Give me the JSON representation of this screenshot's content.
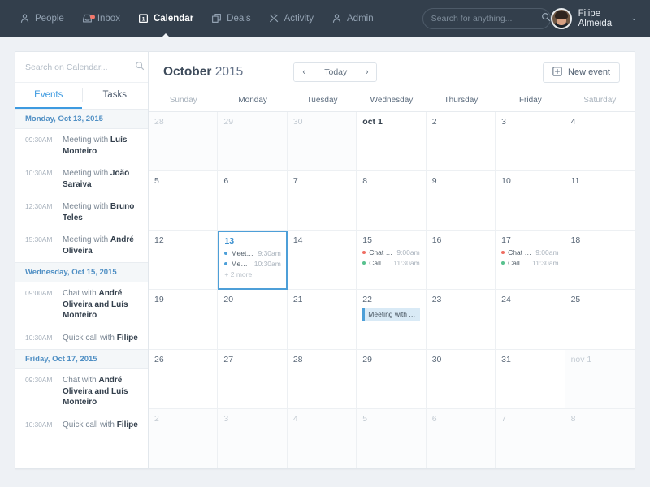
{
  "topnav": {
    "items": [
      {
        "label": "People",
        "icon": "people-icon",
        "active": false,
        "badge": false
      },
      {
        "label": "Inbox",
        "icon": "inbox-icon",
        "active": false,
        "badge": true
      },
      {
        "label": "Calendar",
        "icon": "calendar-icon",
        "active": true,
        "badge": false
      },
      {
        "label": "Deals",
        "icon": "deals-icon",
        "active": false,
        "badge": false
      },
      {
        "label": "Activity",
        "icon": "activity-icon",
        "active": false,
        "badge": false
      },
      {
        "label": "Admin",
        "icon": "admin-icon",
        "active": false,
        "badge": false
      }
    ],
    "search": {
      "placeholder": "Search for anything...",
      "value": "",
      "icon": "search-icon"
    },
    "user": {
      "name": "Filipe Almeida",
      "caret": "⌄",
      "avatar": "avatar"
    },
    "bar_color": "#333f4c",
    "accent_color": "#3d9ae0",
    "badge_color": "#f2776b"
  },
  "sidebar": {
    "search": {
      "placeholder": "Search on Calendar...",
      "value": "",
      "icon": "search-icon"
    },
    "tabs": [
      {
        "label": "Events",
        "active": true
      },
      {
        "label": "Tasks",
        "active": false
      }
    ],
    "days": [
      {
        "header": "Monday, Oct 13, 2015",
        "events": [
          {
            "time": "09:30AM",
            "prefix": "Meeting with ",
            "name": "Luís Monteiro"
          },
          {
            "time": "10:30AM",
            "prefix": "Meeting with ",
            "name": "João Saraiva"
          },
          {
            "time": "12:30AM",
            "prefix": "Meeting with ",
            "name": "Bruno Teles"
          },
          {
            "time": "15:30AM",
            "prefix": "Meeting with ",
            "name": "André Oliveira"
          }
        ]
      },
      {
        "header": "Wednesday, Oct 15, 2015",
        "events": [
          {
            "time": "09:00AM",
            "prefix": "Chat with ",
            "name": "André Oliveira and Luís Monteiro"
          },
          {
            "time": "10:30AM",
            "prefix": "Quick call with ",
            "name": "Filipe"
          }
        ]
      },
      {
        "header": "Friday, Oct 17, 2015",
        "events": [
          {
            "time": "09:30AM",
            "prefix": "Chat with ",
            "name": "André Oliveira and Luís Monteiro"
          },
          {
            "time": "10:30AM",
            "prefix": "Quick call with ",
            "name": "Filipe"
          }
        ]
      }
    ]
  },
  "calendar": {
    "month": "October",
    "year": "2015",
    "prev_label": "‹",
    "today_label": "Today",
    "next_label": "›",
    "new_event_label": "New event",
    "new_event_icon": "plus-square-icon",
    "weekdays": [
      {
        "label": "Sunday",
        "weekend": true
      },
      {
        "label": "Monday",
        "weekend": false
      },
      {
        "label": "Tuesday",
        "weekend": false
      },
      {
        "label": "Wednesday",
        "weekend": false
      },
      {
        "label": "Thursday",
        "weekend": false
      },
      {
        "label": "Friday",
        "weekend": false
      },
      {
        "label": "Saturday",
        "weekend": true
      }
    ],
    "cells": [
      {
        "day": "28",
        "other": true
      },
      {
        "day": "29",
        "other": true
      },
      {
        "day": "30",
        "other": true
      },
      {
        "day": "oct 1",
        "first": true
      },
      {
        "day": "2"
      },
      {
        "day": "3"
      },
      {
        "day": "4"
      },
      {
        "day": "5"
      },
      {
        "day": "6"
      },
      {
        "day": "7"
      },
      {
        "day": "8"
      },
      {
        "day": "9"
      },
      {
        "day": "10"
      },
      {
        "day": "11"
      },
      {
        "day": "12"
      },
      {
        "day": "13",
        "selected": true,
        "events": [
          {
            "name": "Meeting w…",
            "time": "9:30am",
            "color": "#4d9fd8"
          },
          {
            "name": "Meeting…",
            "time": "10:30am",
            "color": "#4d9fd8"
          }
        ],
        "more": "+ 2 more"
      },
      {
        "day": "14"
      },
      {
        "day": "15",
        "events": [
          {
            "name": "Chat with..",
            "time": "9:00am",
            "color": "#ef6d62"
          },
          {
            "name": "Call with..",
            "time": "11:30am",
            "color": "#58c18e"
          }
        ]
      },
      {
        "day": "16"
      },
      {
        "day": "17",
        "events": [
          {
            "name": "Chat with..",
            "time": "9:00am",
            "color": "#ef6d62"
          },
          {
            "name": "Call with..",
            "time": "11:30am",
            "color": "#58c18e"
          }
        ]
      },
      {
        "day": "18"
      },
      {
        "day": "19"
      },
      {
        "day": "20"
      },
      {
        "day": "21"
      },
      {
        "day": "22",
        "bar_event": "Meeting with Andr…"
      },
      {
        "day": "23"
      },
      {
        "day": "24"
      },
      {
        "day": "25"
      },
      {
        "day": "26"
      },
      {
        "day": "27"
      },
      {
        "day": "28"
      },
      {
        "day": "29"
      },
      {
        "day": "30"
      },
      {
        "day": "31"
      },
      {
        "day": "nov 1",
        "other": true
      },
      {
        "day": "2",
        "other": true
      },
      {
        "day": "3",
        "other": true
      },
      {
        "day": "4",
        "other": true
      },
      {
        "day": "5",
        "other": true
      },
      {
        "day": "6",
        "other": true
      },
      {
        "day": "7",
        "other": true
      },
      {
        "day": "8",
        "other": true
      }
    ]
  }
}
